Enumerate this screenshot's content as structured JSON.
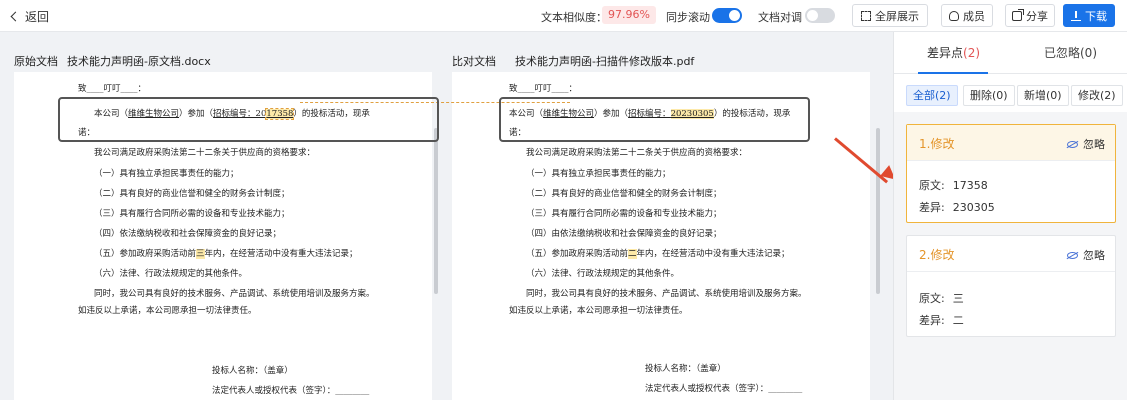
{
  "toolbar": {
    "back_label": "返回",
    "similarity_label": "文本相似度：",
    "similarity_value": "97.96%",
    "sync_scroll_label": "同步滚动",
    "sync_scroll_on": true,
    "align_label": "文档对调",
    "align_on": false,
    "fullscreen_label": "全屏展示",
    "members_label": "成员",
    "share_label": "分享",
    "download_label": "下载"
  },
  "original": {
    "label": "原始文档",
    "filename": "技术能力声明函-原文档.docx",
    "lines": {
      "l0": "致____叮叮____：",
      "l1a": "本公司（",
      "l1b": "维维生物公司",
      "l1c": "）参加（",
      "l1d": "招标编号：20",
      "l1e": "17358",
      "l1f": "）的投标活动，现承",
      "l1g": "诺：",
      "l2": "我公司满足政府采购法第二十二条关于供应商的资格要求：",
      "l3": "（一）具有独立承担民事责任的能力；",
      "l4": "（二）具有良好的商业信誉和健全的财务会计制度；",
      "l5": "（三）具有履行合同所必需的设备和专业技术能力；",
      "l6": "（四）依法缴纳税收和社会保障资金的良好记录；",
      "l7a": "（五）参加政府采购活动前",
      "l7b": "三",
      "l7c": "年内，在经营活动中没有重大违法记录；",
      "l8": "（六）法律、行政法规规定的其他条件。",
      "l9": "同时，我公司具有良好的技术服务、产品调试、系统使用培训及服务方案。",
      "l10": "如违反以上承诺，本公司愿承担一切法律责任。",
      "l11": "投标人名称：（盖章）",
      "l12": "法定代表人或授权代表（签字）：________"
    }
  },
  "compare": {
    "label": "比对文档",
    "filename": "技术能力声明函-扫描件修改版本.pdf",
    "lines": {
      "l0": "致____叮叮____：",
      "l1a": "本公司（",
      "l1b": "维维生物公司",
      "l1c": "）参加（",
      "l1d": "招标编号：",
      "l1e": "20230305",
      "l1f": "）的投标活动，现承",
      "l1g": "诺：",
      "l2": "我公司满足政府采购法第二十二条关于供应商的资格要求：",
      "l3": "（一）具有独立承担民事责任的能力；",
      "l4": "（二）具有良好的商业信誉和健全的财务会计制度；",
      "l5": "（三）具有履行合同所必需的设备和专业技术能力；",
      "l6": "（四）由依法缴纳税收和社会保障资金的良好记录；",
      "l7a": "（五）参加政府采购活动前",
      "l7b": "二",
      "l7c": "年内，在经营活动中没有重大违法记录；",
      "l8": "（六）法律、行政法规规定的其他条件。",
      "l9": "同时，我公司具有良好的技术服务、产品调试、系统使用培训及服务方案。",
      "l10": "如违反以上承诺，本公司愿承担一切法律责任。",
      "l11": "投标人名称：（盖章）",
      "l12": "法定代表人或授权代表（签字）：________"
    }
  },
  "sidebar": {
    "tab_diff_label": "差异点",
    "tab_diff_count": "(2)",
    "tab_ignored_label": "已忽略(0)",
    "filters": [
      "全部(2)",
      "删除(0)",
      "新增(0)",
      "修改(2)"
    ],
    "cards": [
      {
        "title": "1.修改",
        "ignore": "忽略",
        "orig_key": "原文:",
        "orig_val": "17358",
        "diff_key": "差异:",
        "diff_val": "230305"
      },
      {
        "title": "2.修改",
        "ignore": "忽略",
        "orig_key": "原文:",
        "orig_val": "三",
        "diff_key": "差异:",
        "diff_val": "二"
      }
    ]
  },
  "colors": {
    "accent": "#1a73e8",
    "warning": "#e4952a",
    "similarity_red": "#e25555",
    "arrow": "#e04a2f"
  }
}
